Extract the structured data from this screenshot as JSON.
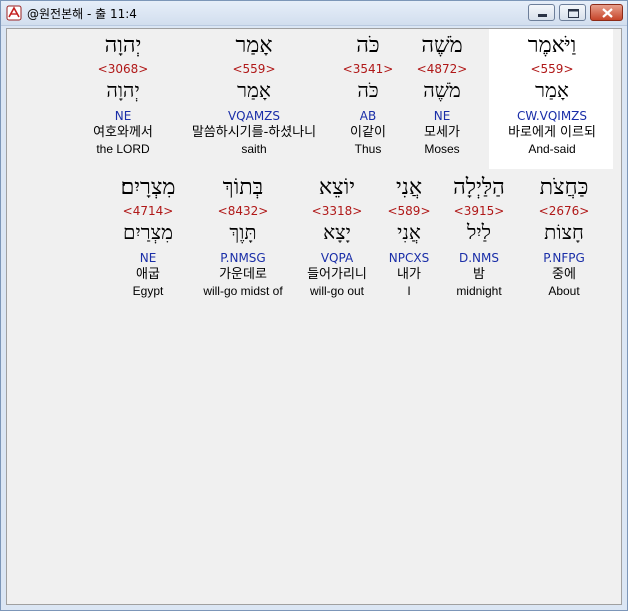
{
  "window": {
    "title": "@원전본해 - 출 11:4"
  },
  "rows": [
    {
      "words": [
        {
          "heb": "וַיֹּאמֶר",
          "strong": "<559>",
          "lex": "אָמַר",
          "morph": "CW.VQIMZS",
          "ko": "바로에게 이르되",
          "en": "And-said"
        },
        {
          "heb": "מֹשֶׁה",
          "strong": "<4872>",
          "lex": "מֹשֶׁה",
          "morph": "NE",
          "ko": "모세가",
          "en": "Moses"
        },
        {
          "heb": "כֹּה",
          "strong": "<3541>",
          "lex": "כֹּה",
          "morph": "AB",
          "ko": "이같이",
          "en": "Thus"
        },
        {
          "heb": "אָמַר",
          "strong": "<559>",
          "lex": "אָמַר",
          "morph": "VQAMZS",
          "ko": "말씀하시기를-하셨나니",
          "en": "saith"
        },
        {
          "heb": "יְהוָה",
          "strong": "<3068>",
          "lex": "יְהוָה",
          "morph": "NE",
          "ko": "여호와께서",
          "en": "the LORD"
        }
      ]
    },
    {
      "words": [
        {
          "heb": "כַּחֲצֹת",
          "strong": "<2676>",
          "lex": "חָצוֹת",
          "morph": "P.NFPG",
          "ko": "중에",
          "en": "About"
        },
        {
          "heb": "הַלַּיְלָה",
          "strong": "<3915>",
          "lex": "לַיִל",
          "morph": "D.NMS",
          "ko": "밤",
          "en": "midnight"
        },
        {
          "heb": "אֲנִי",
          "strong": "<589>",
          "lex": "אֲנִי",
          "morph": "NPCXS",
          "ko": "내가",
          "en": "I"
        },
        {
          "heb": "יוֹצֵא",
          "strong": "<3318>",
          "lex": "יָצָא",
          "morph": "VQPA",
          "ko": "들어가리니",
          "en": "will-go out"
        },
        {
          "heb": "בְּתוֹךְ",
          "strong": "<8432>",
          "lex": "תָּוֶךְ",
          "morph": "P.NMSG",
          "ko": "가운데로",
          "en": "will-go midst of"
        },
        {
          "heb": "מִצְרָיִם׃",
          "strong": "<4714>",
          "lex": "מִצְרַיִם",
          "morph": "NE",
          "ko": "애굽",
          "en": "Egypt"
        }
      ]
    }
  ]
}
